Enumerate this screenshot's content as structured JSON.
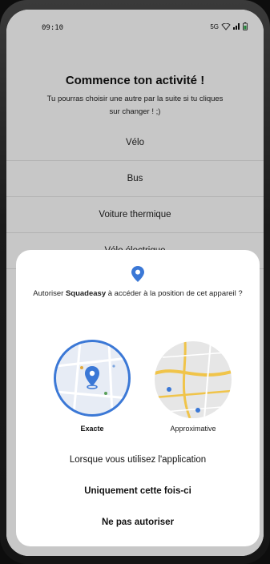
{
  "status_bar": {
    "time": "09:10",
    "network": "5G"
  },
  "page": {
    "title": "Commence ton activité !",
    "subtitle": "Tu pourras choisir une autre par la suite si tu cliques sur changer ! ;)",
    "options": [
      "Vélo",
      "Bus",
      "Voiture thermique",
      "Vélo électrique"
    ]
  },
  "dialog": {
    "prompt_prefix": "Autoriser ",
    "app_name": "Squadeasy",
    "prompt_suffix": " à accéder à la position de cet appareil ?",
    "exact_label": "Exacte",
    "approx_label": "Approximative",
    "actions": [
      "Lorsque vous utilisez l'application",
      "Uniquement cette fois-ci",
      "Ne pas autoriser"
    ]
  },
  "colors": {
    "accent": "#3b78d6",
    "scrim": "rgba(0,0,0,0.22)"
  }
}
